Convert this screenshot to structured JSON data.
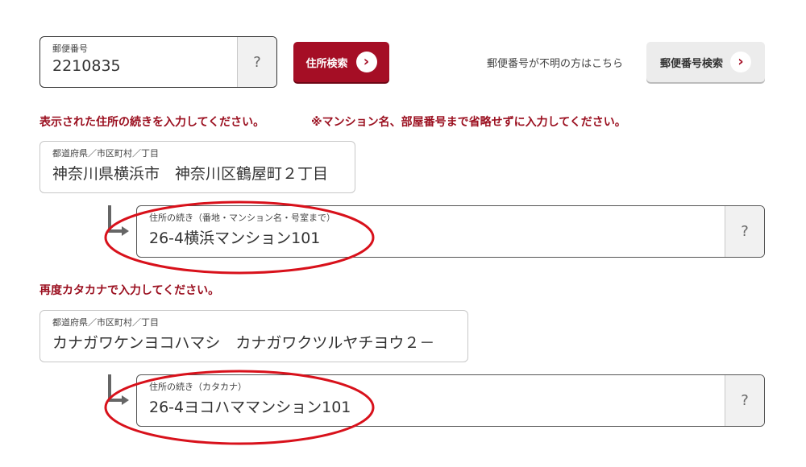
{
  "postal": {
    "label": "郵便番号",
    "value": "2210835",
    "help": "?"
  },
  "search_button": {
    "label": "住所検索",
    "icon": "chevron-right-icon"
  },
  "unknown_text": "郵便番号が不明の方はこちら",
  "postal_search_button": {
    "label": "郵便番号検索",
    "icon": "chevron-right-icon"
  },
  "heading_address": {
    "main": "表示された住所の続きを入力してください。",
    "note": "※マンション名、部屋番号まで省略せずに入力してください。"
  },
  "address": {
    "label": "都道府県／市区町村／丁目",
    "value": "神奈川県横浜市　神奈川区鶴屋町２丁目"
  },
  "address_cont": {
    "label": "住所の続き（番地・マンション名・号室まで）",
    "value": "26-4横浜マンション101",
    "help": "?"
  },
  "heading_kana": "再度カタカナで入力してください。",
  "kana": {
    "label": "都道府県／市区町村／丁目",
    "value": "カナガワケンヨコハマシ　カナガワクツルヤチヨウ２－"
  },
  "kana_cont": {
    "label": "住所の続き（カタカナ）",
    "value": "26-4ヨコハママンション101",
    "help": "?"
  },
  "colors": {
    "accent": "#a50e25",
    "heading": "#9b1020",
    "annotation": "#d8111b"
  }
}
